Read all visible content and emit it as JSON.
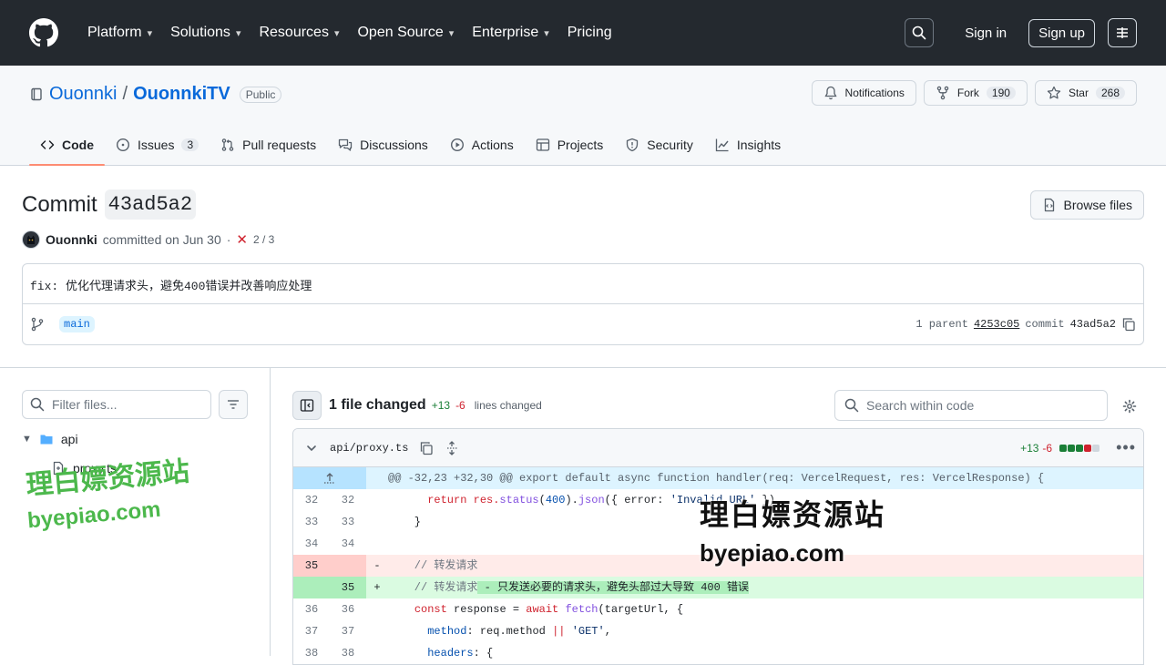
{
  "header": {
    "nav": [
      {
        "label": "Platform",
        "caret": true
      },
      {
        "label": "Solutions",
        "caret": true
      },
      {
        "label": "Resources",
        "caret": true
      },
      {
        "label": "Open Source",
        "caret": true
      },
      {
        "label": "Enterprise",
        "caret": true
      },
      {
        "label": "Pricing",
        "caret": false
      }
    ],
    "sign_in": "Sign in",
    "sign_up": "Sign up"
  },
  "repo": {
    "owner": "Ouonnki",
    "separator": "/",
    "name": "OuonnkiTV",
    "visibility": "Public",
    "notifications_label": "Notifications",
    "fork_label": "Fork",
    "fork_count": "190",
    "star_label": "Star",
    "star_count": "268",
    "tabs": [
      {
        "label": "Code",
        "icon": "code-icon",
        "count": ""
      },
      {
        "label": "Issues",
        "icon": "issue-icon",
        "count": "3"
      },
      {
        "label": "Pull requests",
        "icon": "pull-request-icon",
        "count": ""
      },
      {
        "label": "Discussions",
        "icon": "discussions-icon",
        "count": ""
      },
      {
        "label": "Actions",
        "icon": "play-icon",
        "count": ""
      },
      {
        "label": "Projects",
        "icon": "table-icon",
        "count": ""
      },
      {
        "label": "Security",
        "icon": "shield-icon",
        "count": ""
      },
      {
        "label": "Insights",
        "icon": "graph-icon",
        "count": ""
      }
    ]
  },
  "commit": {
    "title_word": "Commit",
    "sha_short": "43ad5a2",
    "browse_files": "Browse files",
    "author": "Ouonnki",
    "committed_text": "committed on Jun 30",
    "dot": "·",
    "checks": "2 / 3",
    "message": "fix: 优化代理请求头，避免400错误并改善响应处理",
    "branch": "main",
    "parent_label": "1 parent",
    "parent_sha": "4253c05",
    "commit_label": "commit",
    "commit_sha": "43ad5a2"
  },
  "tree": {
    "filter_placeholder": "Filter files...",
    "dir": "api",
    "file": "proxy.ts"
  },
  "diff": {
    "files_changed": "1 file changed",
    "additions": "+13",
    "deletions": "-6",
    "lines_changed": "lines changed",
    "search_placeholder": "Search within code",
    "file_name": "api/proxy.ts",
    "file_additions": "+13",
    "file_deletions": "-6",
    "block_colors": [
      "#1a7f37",
      "#1a7f37",
      "#1a7f37",
      "#cf222e",
      "#d0d7de"
    ],
    "hunk_header": "@@ -32,23 +32,30 @@ export default async function handler(req: VercelRequest, res: VercelResponse) {",
    "lines": [
      {
        "old": "32",
        "new": "32",
        "sign": "",
        "type": "ctx"
      },
      {
        "old": "33",
        "new": "33",
        "sign": "",
        "type": "ctx"
      },
      {
        "old": "34",
        "new": "34",
        "sign": "",
        "type": "ctx"
      },
      {
        "old": "35",
        "new": "",
        "sign": "-",
        "type": "del"
      },
      {
        "old": "",
        "new": "35",
        "sign": "+",
        "type": "add"
      },
      {
        "old": "36",
        "new": "36",
        "sign": "",
        "type": "ctx"
      },
      {
        "old": "37",
        "new": "37",
        "sign": "",
        "type": "ctx"
      },
      {
        "old": "38",
        "new": "38",
        "sign": "",
        "type": "ctx"
      }
    ],
    "code_text": {
      "l32_a": "      return res.",
      "l32_fn1": "status",
      "l32_b": "(",
      "l32_num": "400",
      "l32_c": ").",
      "l32_fn2": "json",
      "l32_d": "({ error: ",
      "l32_str": "'Invalid URL'",
      "l32_e": " })",
      "l33": "    }",
      "l35_del": "    // 转发请求",
      "l35_add_a": "    // 转发请求",
      "l35_add_b": " - 只发送必要的请求头，避免头部过大导致 400 错误",
      "l36_kw1": "const",
      "l36_a": " response = ",
      "l36_kw2": "await",
      "l36_fn": "fetch",
      "l36_b": "(targetUrl, {",
      "l37_prop": "method",
      "l37_a": ": req.",
      "l37_prop2": "method",
      "l37_op": "||",
      "l37_str": "'GET'",
      "l37_b": ",",
      "l38_prop": "headers",
      "l38_a": ": {"
    }
  },
  "watermark": {
    "cn": "理白嫖资源站",
    "url": "byepiao.com"
  }
}
